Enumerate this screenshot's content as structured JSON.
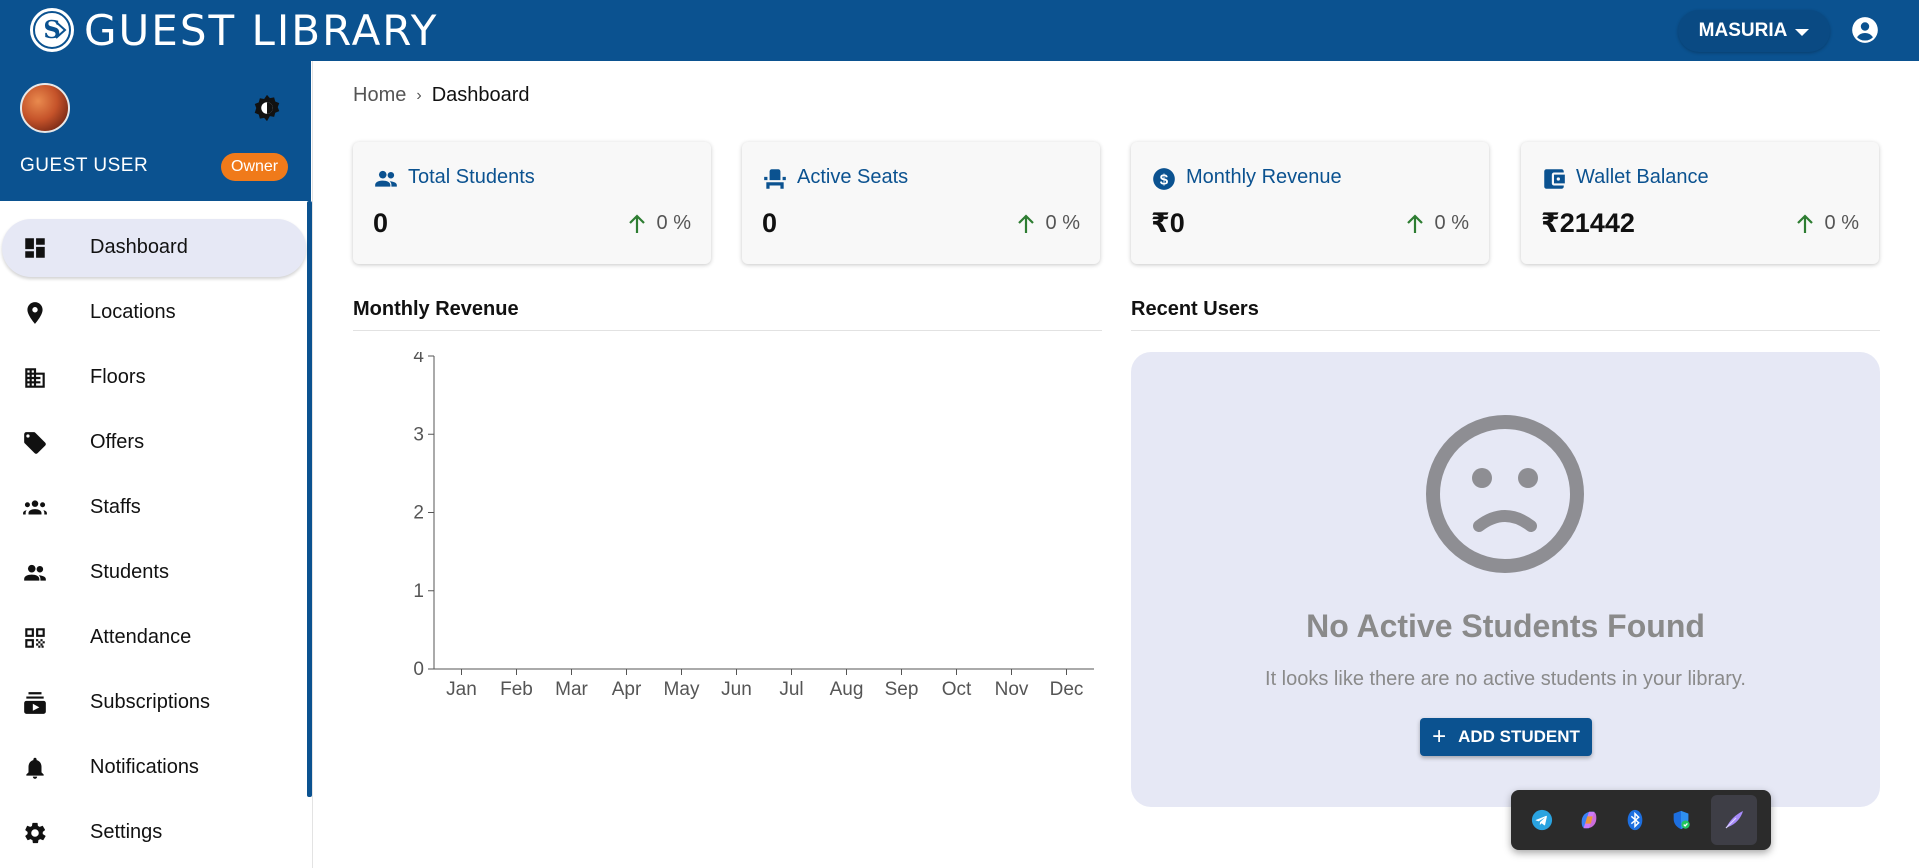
{
  "app": {
    "brand": "GUEST LIBRARY",
    "location_selector": "MASURIA"
  },
  "profile": {
    "user_name": "GUEST USER",
    "role": "Owner"
  },
  "sidebar": {
    "items": [
      {
        "label": "Dashboard",
        "icon": "dashboard-icon",
        "active": true
      },
      {
        "label": "Locations",
        "icon": "location-pin-icon"
      },
      {
        "label": "Floors",
        "icon": "building-icon"
      },
      {
        "label": "Offers",
        "icon": "tag-icon"
      },
      {
        "label": "Staffs",
        "icon": "groups-icon"
      },
      {
        "label": "Students",
        "icon": "people-icon"
      },
      {
        "label": "Attendance",
        "icon": "qr-code-icon"
      },
      {
        "label": "Subscriptions",
        "icon": "subscriptions-icon"
      },
      {
        "label": "Notifications",
        "icon": "bell-icon"
      },
      {
        "label": "Settings",
        "icon": "gear-icon"
      }
    ]
  },
  "breadcrumb": {
    "home": "Home",
    "separator": "›",
    "current": "Dashboard"
  },
  "stats": [
    {
      "title": "Total Students",
      "value": "0",
      "trend": "0 %",
      "icon": "people-icon"
    },
    {
      "title": "Active Seats",
      "value": "0",
      "trend": "0 %",
      "icon": "seat-icon"
    },
    {
      "title": "Monthly Revenue",
      "value": "₹0",
      "trend": "0 %",
      "icon": "dollar-circle-icon"
    },
    {
      "title": "Wallet Balance",
      "value": "₹21442",
      "trend": "0 %",
      "icon": "wallet-icon"
    }
  ],
  "revenue_section": {
    "title": "Monthly Revenue"
  },
  "recent_users": {
    "title": "Recent Users",
    "empty_title": "No Active Students Found",
    "empty_message": "It looks like there are no active students in your library.",
    "add_button": "ADD STUDENT"
  },
  "chart_data": {
    "type": "bar",
    "categories": [
      "Jan",
      "Feb",
      "Mar",
      "Apr",
      "May",
      "Jun",
      "Jul",
      "Aug",
      "Sep",
      "Oct",
      "Nov",
      "Dec"
    ],
    "values": [
      0,
      0,
      0,
      0,
      0,
      0,
      0,
      0,
      0,
      0,
      0,
      0
    ],
    "yticks": [
      0,
      1,
      2,
      3,
      4
    ],
    "ylim": [
      0,
      4
    ],
    "title": "",
    "xlabel": "",
    "ylabel": "",
    "grid": false
  },
  "colors": {
    "primary": "#0b5290",
    "badge": "#f07a1a",
    "trend_up": "#2e7d32",
    "empty_bg": "#e6e8f5"
  },
  "tray": {
    "icons": [
      "telegram-icon",
      "copilot-icon",
      "bluetooth-icon",
      "security-shield-icon",
      "feather-pen-icon"
    ]
  }
}
